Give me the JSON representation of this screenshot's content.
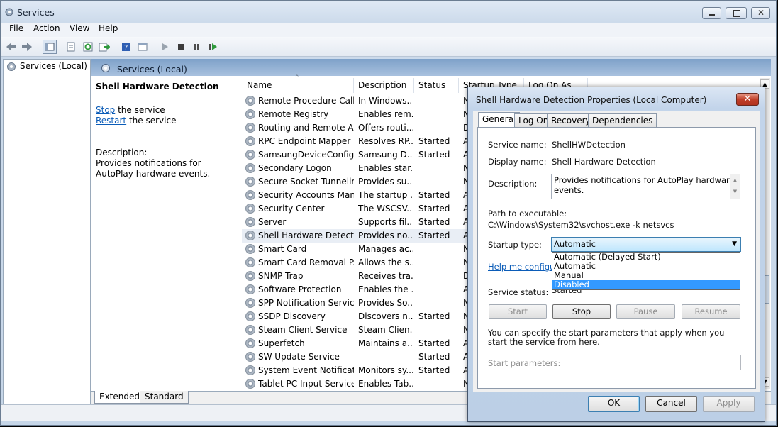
{
  "window": {
    "title": "Services"
  },
  "menu": [
    "File",
    "Action",
    "View",
    "Help"
  ],
  "tree": {
    "root": "Services (Local)"
  },
  "panel_title": "Services (Local)",
  "detail": {
    "title": "Shell Hardware Detection",
    "stop_link": "Stop",
    "stop_rest": " the service",
    "restart_link": "Restart",
    "restart_rest": " the service",
    "desc_label": "Description:",
    "desc_text": "Provides notifications for AutoPlay hardware events."
  },
  "columns": [
    "Name",
    "Description",
    "Status",
    "Startup Type",
    "Log On As"
  ],
  "services": [
    {
      "name": "Remote Procedure Call ...",
      "desc": "In Windows...",
      "status": "",
      "startup": "N"
    },
    {
      "name": "Remote Registry",
      "desc": "Enables rem...",
      "status": "",
      "startup": "N"
    },
    {
      "name": "Routing and Remote A...",
      "desc": "Offers routi...",
      "status": "",
      "startup": "D"
    },
    {
      "name": "RPC Endpoint Mapper",
      "desc": "Resolves RP...",
      "status": "Started",
      "startup": "A"
    },
    {
      "name": "SamsungDeviceConfig...",
      "desc": "Samsung D...",
      "status": "Started",
      "startup": "A"
    },
    {
      "name": "Secondary Logon",
      "desc": "Enables star...",
      "status": "",
      "startup": "N"
    },
    {
      "name": "Secure Socket Tunnelin...",
      "desc": "Provides su...",
      "status": "",
      "startup": "N"
    },
    {
      "name": "Security Accounts Man...",
      "desc": "The startup ...",
      "status": "Started",
      "startup": "A"
    },
    {
      "name": "Security Center",
      "desc": "The WSCSV...",
      "status": "Started",
      "startup": "A"
    },
    {
      "name": "Server",
      "desc": "Supports fil...",
      "status": "Started",
      "startup": "A"
    },
    {
      "name": "Shell Hardware Detection",
      "desc": "Provides no...",
      "status": "Started",
      "startup": "A"
    },
    {
      "name": "Smart Card",
      "desc": "Manages ac...",
      "status": "",
      "startup": "N"
    },
    {
      "name": "Smart Card Removal P...",
      "desc": "Allows the s...",
      "status": "",
      "startup": "N"
    },
    {
      "name": "SNMP Trap",
      "desc": "Receives tra...",
      "status": "",
      "startup": "D"
    },
    {
      "name": "Software Protection",
      "desc": "Enables the ...",
      "status": "",
      "startup": "A"
    },
    {
      "name": "SPP Notification Service",
      "desc": "Provides So...",
      "status": "",
      "startup": "N"
    },
    {
      "name": "SSDP Discovery",
      "desc": "Discovers n...",
      "status": "Started",
      "startup": "N"
    },
    {
      "name": "Steam Client Service",
      "desc": "Steam Clien...",
      "status": "",
      "startup": "N"
    },
    {
      "name": "Superfetch",
      "desc": "Maintains a...",
      "status": "Started",
      "startup": "A"
    },
    {
      "name": "SW Update Service",
      "desc": "",
      "status": "Started",
      "startup": "A"
    },
    {
      "name": "System Event Notificati...",
      "desc": "Monitors sy...",
      "status": "Started",
      "startup": "A"
    },
    {
      "name": "Tablet PC Input Service",
      "desc": "Enables Tab...",
      "status": "",
      "startup": "N"
    }
  ],
  "bottom_tabs": [
    "Extended",
    "Standard"
  ],
  "dialog": {
    "title": "Shell Hardware Detection Properties (Local Computer)",
    "tabs": [
      "General",
      "Log On",
      "Recovery",
      "Dependencies"
    ],
    "service_name_label": "Service name:",
    "service_name": "ShellHWDetection",
    "display_name_label": "Display name:",
    "display_name": "Shell Hardware Detection",
    "description_label": "Description:",
    "description": "Provides notifications for AutoPlay hardware events.",
    "path_label": "Path to executable:",
    "path": "C:\\Windows\\System32\\svchost.exe -k netsvcs",
    "startup_label": "Startup type:",
    "startup_value": "Automatic",
    "startup_options": [
      "Automatic (Delayed Start)",
      "Automatic",
      "Manual",
      "Disabled"
    ],
    "help_link": "Help me configure",
    "status_label": "Service status:",
    "status_value": "Started",
    "buttons": {
      "start": "Start",
      "stop": "Stop",
      "pause": "Pause",
      "resume": "Resume"
    },
    "hint": "You can specify the start parameters that apply when you start the service from here.",
    "params_label": "Start parameters:",
    "ok": "OK",
    "cancel": "Cancel",
    "apply": "Apply"
  }
}
